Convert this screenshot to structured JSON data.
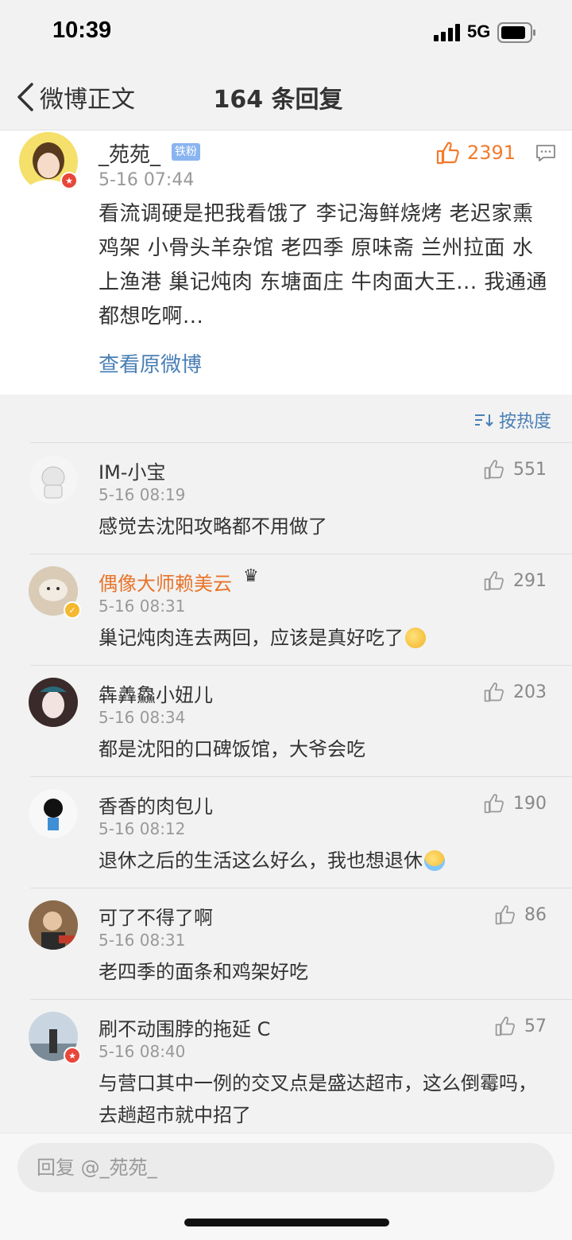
{
  "status": {
    "time": "10:39",
    "network": "5G"
  },
  "nav": {
    "back_label": "微博正文",
    "title": "164 条回复"
  },
  "main_comment": {
    "username": "_苑苑_",
    "badge": "铁粉",
    "time": "5-16 07:44",
    "likes": "2391",
    "text": "看流调硬是把我看饿了 李记海鲜烧烤 老迟家熏鸡架 小骨头羊杂馆 老四季 原味斋 兰州拉面 水上渔港 巢记炖肉 东塘面庄 牛肉面大王... 我通通都想吃啊...",
    "view_original": "查看原微博"
  },
  "sort": {
    "label": "按热度"
  },
  "comments": [
    {
      "name": "IM-小宝",
      "time": "5-16 08:19",
      "likes": "551",
      "text": "感觉去沈阳攻略都不用做了"
    },
    {
      "name": "偶像大师赖美云",
      "time": "5-16 08:31",
      "likes": "291",
      "text": "巢记炖肉连去两回，应该是真好吃了"
    },
    {
      "name": "犇羴鱻小妞儿",
      "time": "5-16 08:34",
      "likes": "203",
      "text": "都是沈阳的口碑饭馆，大爷会吃"
    },
    {
      "name": "香香的肉包儿",
      "time": "5-16 08:12",
      "likes": "190",
      "text": "退休之后的生活这么好么，我也想退休"
    },
    {
      "name": "可了不得了啊",
      "time": "5-16 08:31",
      "likes": "86",
      "text": "老四季的面条和鸡架好吃"
    },
    {
      "name": "刷不动围脖的拖延 C",
      "time": "5-16 08:40",
      "likes": "57",
      "text": "与营口其中一例的交叉点是盛达超市，这么倒霉吗，去趟超市就中招了"
    }
  ],
  "reply": {
    "placeholder": "回复 @_苑苑_"
  },
  "colors": {
    "accent_link": "#4a7fb5",
    "like_orange": "#f37a2c",
    "vip_name": "#e8742a"
  }
}
